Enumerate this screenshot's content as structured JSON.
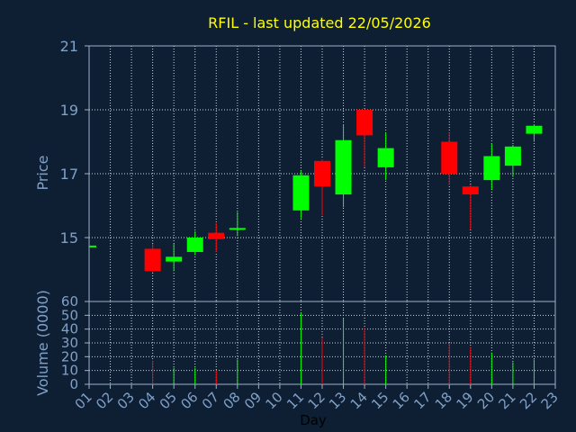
{
  "chart_data": {
    "type": "candlestick",
    "title": "RFIL - last updated 22/05/2026",
    "xlabel": "Day",
    "price_panel": {
      "ylabel": "Price",
      "ylim": [
        13,
        21
      ],
      "yticks": [
        "15",
        "17",
        "19",
        "21"
      ],
      "grid": true
    },
    "volume_panel": {
      "ylabel": "Volume (0000)",
      "ylim": [
        0,
        60
      ],
      "yticks": [
        "0",
        "10",
        "20",
        "30",
        "40",
        "50",
        "60"
      ],
      "grid": true
    },
    "x_ticks": [
      "01",
      "02",
      "03",
      "04",
      "05",
      "06",
      "07",
      "08",
      "09",
      "10",
      "11",
      "12",
      "13",
      "14",
      "15",
      "16",
      "17",
      "18",
      "19",
      "20",
      "21",
      "22",
      "23"
    ],
    "candles": [
      {
        "day": "01",
        "open": 14.75,
        "close": 14.75,
        "high": 14.75,
        "low": 14.75,
        "volume": 0
      },
      {
        "day": "04",
        "open": 14.65,
        "close": 13.95,
        "high": 14.8,
        "low": 13.9,
        "volume": 17
      },
      {
        "day": "05",
        "open": 14.25,
        "close": 14.4,
        "high": 14.8,
        "low": 13.95,
        "volume": 12
      },
      {
        "day": "06",
        "open": 14.55,
        "close": 15.0,
        "high": 15.2,
        "low": 14.45,
        "volume": 12
      },
      {
        "day": "07",
        "open": 15.15,
        "close": 14.95,
        "high": 15.45,
        "low": 14.55,
        "volume": 10
      },
      {
        "day": "08",
        "open": 15.25,
        "close": 15.3,
        "high": 15.8,
        "low": 15.05,
        "volume": 18
      },
      {
        "day": "11",
        "open": 15.85,
        "close": 16.95,
        "high": 17.1,
        "low": 15.6,
        "volume": 52
      },
      {
        "day": "12",
        "open": 17.4,
        "close": 16.6,
        "high": 17.45,
        "low": 15.7,
        "volume": 34
      },
      {
        "day": "13",
        "open": 16.35,
        "close": 18.05,
        "high": 18.55,
        "low": 15.95,
        "volume": 48
      },
      {
        "day": "14",
        "open": 19.0,
        "close": 18.2,
        "high": 19.0,
        "low": 17.2,
        "volume": 41
      },
      {
        "day": "15",
        "open": 17.2,
        "close": 17.8,
        "high": 18.3,
        "low": 16.8,
        "volume": 21
      },
      {
        "day": "18",
        "open": 18.0,
        "close": 17.0,
        "high": 18.3,
        "low": 16.65,
        "volume": 30
      },
      {
        "day": "19",
        "open": 16.6,
        "close": 16.35,
        "high": 16.65,
        "low": 15.25,
        "volume": 27
      },
      {
        "day": "20",
        "open": 16.8,
        "close": 17.55,
        "high": 17.95,
        "low": 16.5,
        "volume": 23
      },
      {
        "day": "21",
        "open": 17.25,
        "close": 17.85,
        "high": 17.9,
        "low": 16.9,
        "volume": 16
      },
      {
        "day": "22",
        "open": 18.25,
        "close": 18.5,
        "high": 18.55,
        "low": 18.0,
        "volume": 18
      }
    ],
    "colors": {
      "background": "#0f1f33",
      "plot_border": "#9ab0c8",
      "grid": "#c8d4e0",
      "title": "#ffff00",
      "axis_text": "#7fa0c8",
      "up": "#00ff00",
      "down": "#ff0000"
    }
  }
}
